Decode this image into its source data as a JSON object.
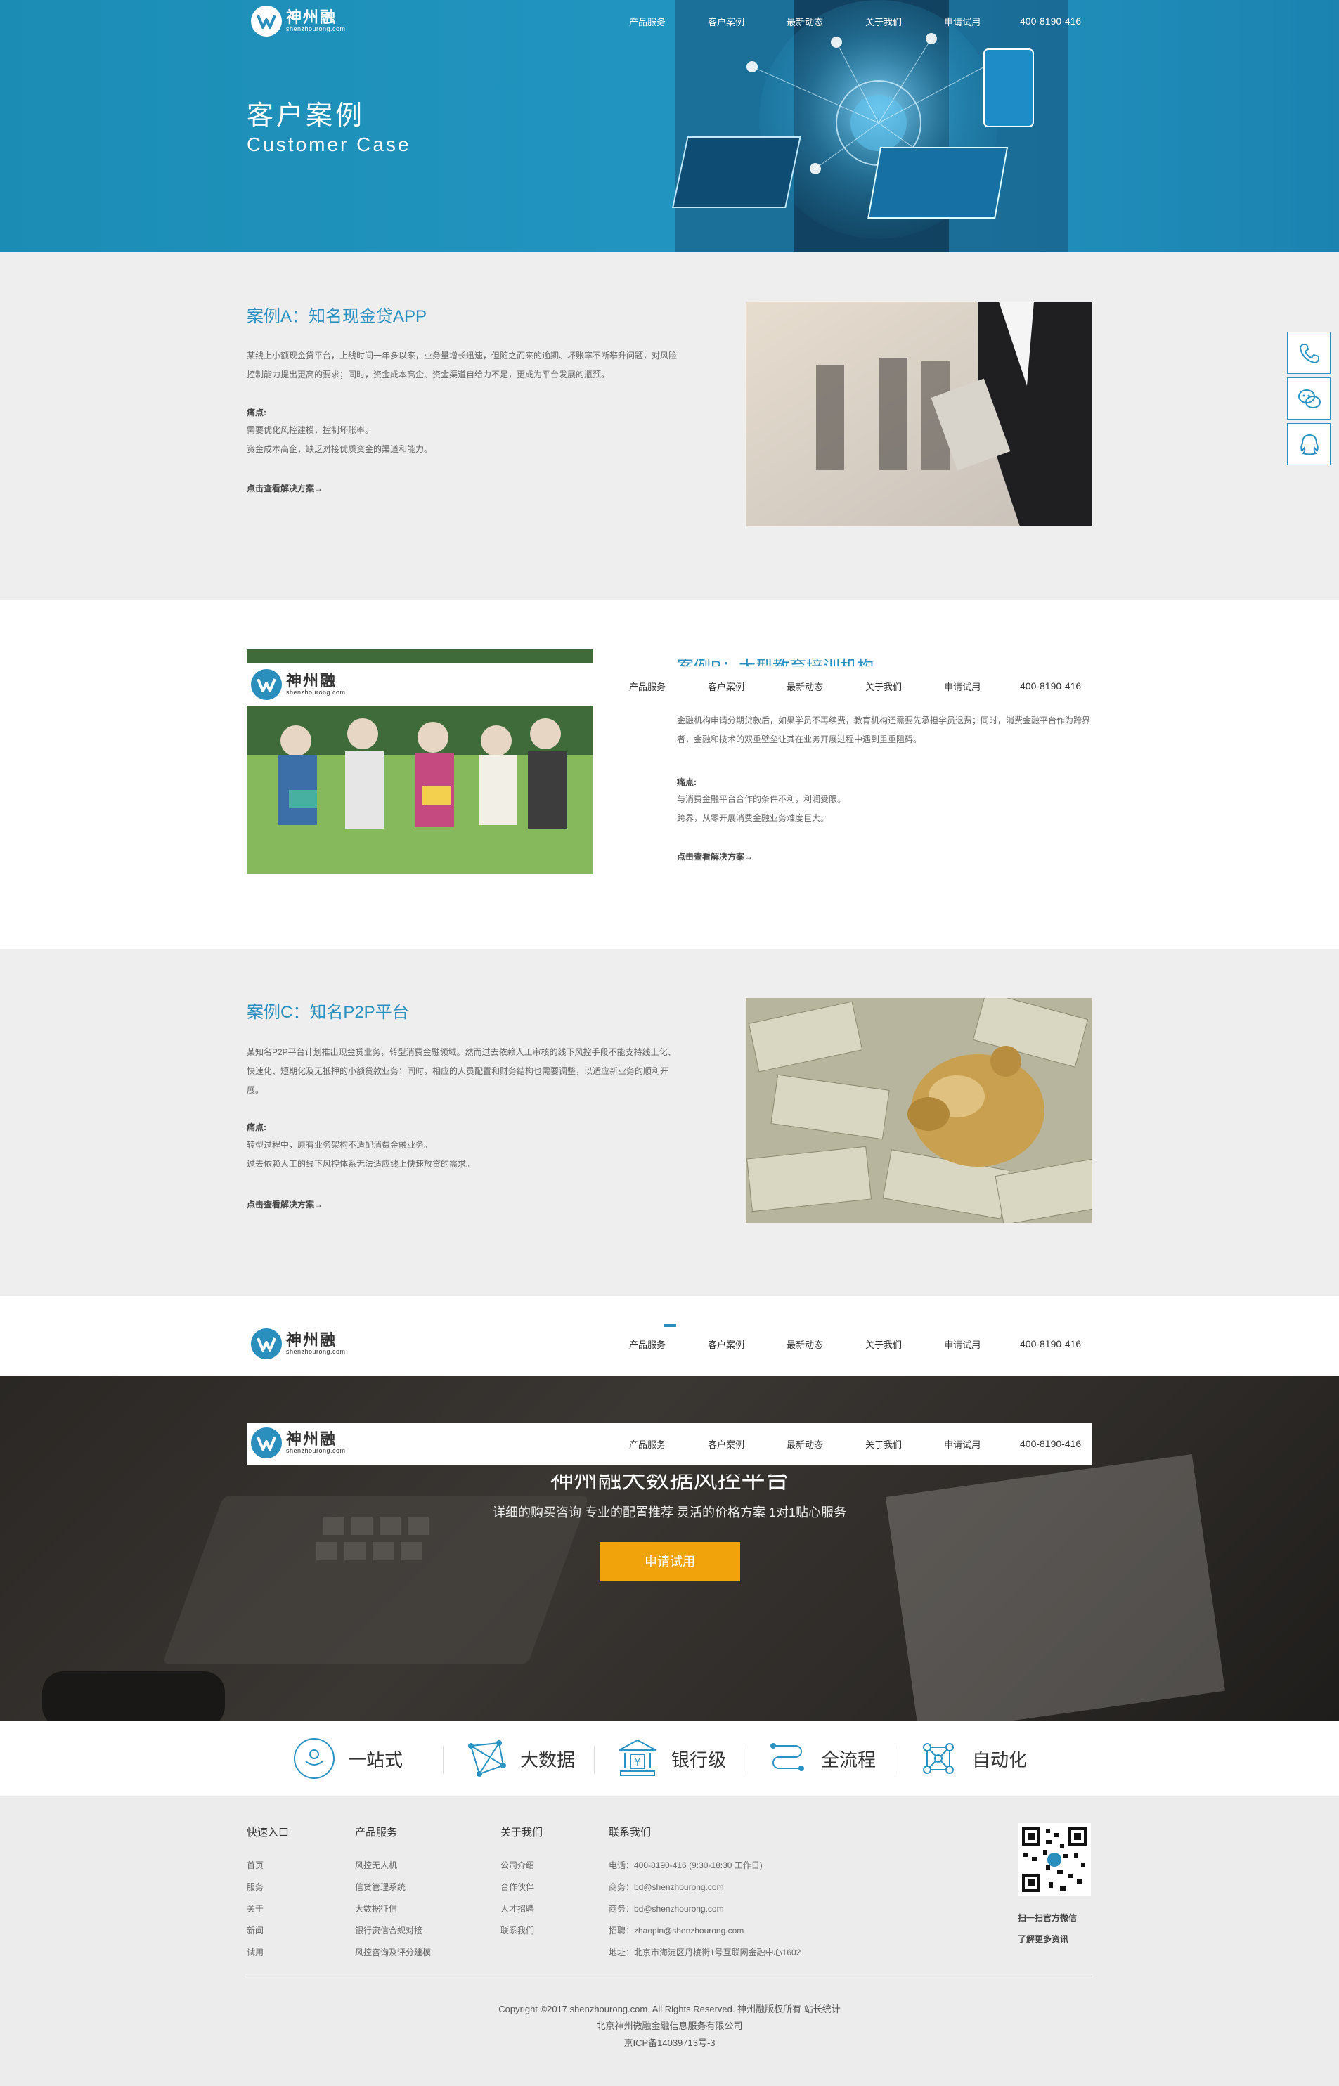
{
  "brand": {
    "name_cn": "神州融",
    "name_en": "shenzhourong.com"
  },
  "nav": {
    "items": [
      "产品服务",
      "客户案例",
      "最新动态",
      "关于我们",
      "申请试用"
    ],
    "phone": "400-8190-416"
  },
  "hero": {
    "title": "客户案例",
    "subtitle": "Customer Case"
  },
  "cases": [
    {
      "title": "案例A：知名现金贷APP",
      "desc": "某线上小额现金贷平台，上线时间一年多以来，业务量增长迅速，但随之而来的逾期、坏账率不断攀升问题，对风险控制能力提出更高的要求；同时，资金成本高企、资金渠道自给力不足，更成为平台发展的瓶颈。",
      "pain_title": "痛点:",
      "pains": [
        "需要优化风控建模，控制坏账率。",
        "资金成本高企，缺乏对接优质资金的渠道和能力。"
      ],
      "more": "点击查看解决方案→"
    },
    {
      "title": "案例B：大型教育培训机构",
      "desc": "金融机构申请分期贷款后，如果学员不再续费，教育机构还需要先承担学员退费；同时，消费金融平台作为跨界者，金融和技术的双重壁垒让其在业务开展过程中遇到重重阻碍。",
      "pain_title": "痛点:",
      "pains": [
        "与消费金融平台合作的条件不利，利润受限。",
        "跨界，从零开展消费金融业务难度巨大。"
      ],
      "more": "点击查看解决方案→"
    },
    {
      "title": "案例C：知名P2P平台",
      "desc": "某知名P2P平台计划推出现金贷业务，转型消费金融领域。然而过去依赖人工审核的线下风控手段不能支持线上化、快速化、短期化及无抵押的小额贷款业务；同时，相应的人员配置和财务结构也需要调整，以适应新业务的顺利开展。",
      "pain_title": "痛点:",
      "pains": [
        "转型过程中，原有业务架构不适配消费金融业务。",
        "过去依赖人工的线下风控体系无法适应线上快速放贷的需求。"
      ],
      "more": "点击查看解决方案→"
    }
  ],
  "cta": {
    "title": "神州融大数据风控平台",
    "subtitle": "详细的购买咨询 专业的配置推荐 灵活的价格方案 1对1贴心服务",
    "button": "申请试用"
  },
  "features": [
    "一站式",
    "大数据",
    "银行级",
    "全流程",
    "自动化"
  ],
  "footer": {
    "cols": [
      {
        "title": "快速入口",
        "items": [
          "首页",
          "服务",
          "关于",
          "新闻",
          "试用"
        ]
      },
      {
        "title": "产品服务",
        "items": [
          "风控无人机",
          "信贷管理系统",
          "大数据征信",
          "银行资信合规对接",
          "风控咨询及评分建模"
        ]
      },
      {
        "title": "关于我们",
        "items": [
          "公司介绍",
          "合作伙伴",
          "人才招聘",
          "联系我们"
        ]
      },
      {
        "title": "联系我们",
        "items": [
          "电话：400-8190-416 (9:30-18:30 工作日)",
          "商务：bd@shenzhourong.com",
          "商务：bd@shenzhourong.com",
          "招聘：zhaopin@shenzhourong.com",
          "地址：北京市海淀区丹棱街1号互联网金融中心1602"
        ]
      }
    ],
    "qr_caption1": "扫一扫官方微信",
    "qr_caption2": "了解更多资讯",
    "copyright": "Copyright ©2017 shenzhourong.com. All Rights Reserved. 神州融版权所有 站长统计",
    "company": "北京神州微融金融信息服务有限公司",
    "icp": "京ICP备14039713号-3"
  },
  "side": [
    "phone-icon",
    "wechat-icon",
    "qq-icon"
  ]
}
